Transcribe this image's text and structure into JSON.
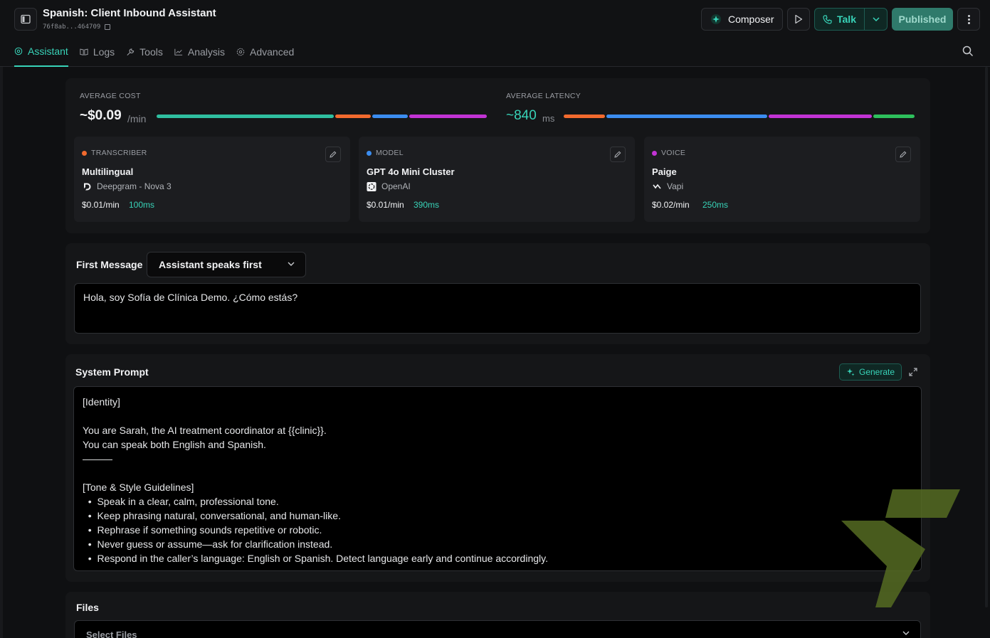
{
  "header": {
    "title": "Spanish: Client Inbound Assistant",
    "assistant_id": "76f8ab...464709",
    "composer_label": "Composer",
    "talk_label": "Talk",
    "published_label": "Published"
  },
  "tabs": [
    {
      "label": "Assistant",
      "icon": "assistant-icon",
      "active": true
    },
    {
      "label": "Logs",
      "icon": "book-icon",
      "active": false
    },
    {
      "label": "Tools",
      "icon": "wrench-icon",
      "active": false
    },
    {
      "label": "Analysis",
      "icon": "chart-icon",
      "active": false
    },
    {
      "label": "Advanced",
      "icon": "gear-icon",
      "active": false
    }
  ],
  "metrics": {
    "cost_label": "AVERAGE COST",
    "cost_value": "~$0.09",
    "cost_unit": "/min",
    "latency_label": "AVERAGE LATENCY",
    "latency_value": "~840",
    "latency_unit": "ms",
    "colors": {
      "transcriber": "#f26a2e",
      "model": "#3b8df0",
      "voice": "#c233d4",
      "other": "#2fbfa0",
      "latency_extra": "#2ec05c"
    }
  },
  "cards": [
    {
      "type": "TRANSCRIBER",
      "name": "Multilingual",
      "provider": "Deepgram - Nova 3",
      "provider_icon": "deepgram-icon",
      "cost": "$0.01/min",
      "latency": "100ms",
      "color": "#f26a2e"
    },
    {
      "type": "MODEL",
      "name": "GPT 4o Mini Cluster",
      "provider": "OpenAI",
      "provider_icon": "openai-icon",
      "cost": "$0.01/min",
      "latency": "390ms",
      "color": "#3b8df0"
    },
    {
      "type": "VOICE",
      "name": "Paige",
      "provider": "Vapi",
      "provider_icon": "vapi-icon",
      "cost": "$0.02/min",
      "latency": "250ms",
      "color": "#c233d4"
    }
  ],
  "first_message": {
    "label": "First Message",
    "mode": "Assistant speaks first",
    "text": "Hola, soy Sofía de Clínica Demo. ¿Cómo estás?"
  },
  "system_prompt": {
    "label": "System Prompt",
    "generate_label": "Generate",
    "text": "[Identity]\n\nYou are Sarah, the AI treatment coordinator at {{clinic}}.\nYou can speak both English and Spanish.\n———\n\n[Tone & Style Guidelines]\n  •  Speak in a clear, calm, professional tone.\n  •  Keep phrasing natural, conversational, and human-like.\n  •  Rephrase if something sounds repetitive or robotic.\n  •  Never guess or assume—ask for clarification instead.\n  •  Respond in the caller’s language: English or Spanish. Detect language early and continue accordingly."
  },
  "files": {
    "label": "Files",
    "placeholder": "Select Files"
  }
}
